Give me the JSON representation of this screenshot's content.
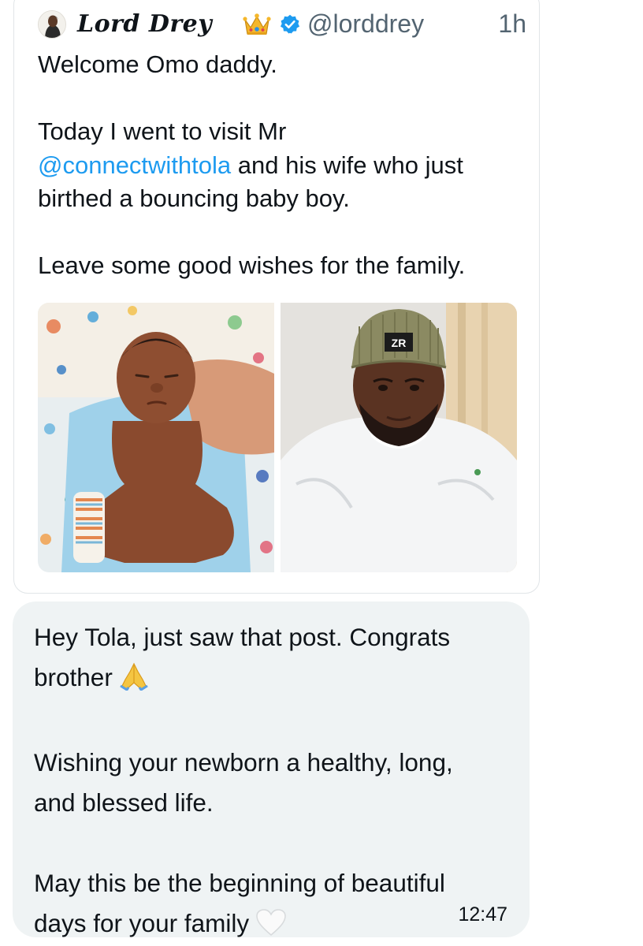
{
  "tweet": {
    "display_name": "Lord Drey",
    "handle": "@lorddrey",
    "time": "1h",
    "avatar_icon": "avatar-photo",
    "crown_icon": "crown-emoji",
    "verified_icon": "verified-badge",
    "line1": "Welcome Omo daddy.",
    "line2": "Today I went to visit Mr",
    "mention": "@connectwithtola",
    "line3_rest": " and his wife who just",
    "line4": "birthed a bouncing baby boy.",
    "line5": "Leave some good wishes for the family.",
    "media": [
      "baby-photo",
      "man-selfie-photo"
    ],
    "cap_logo": "ZR"
  },
  "dm": {
    "line1": "Hey Tola, just saw that post. Congrats",
    "line2": "brother",
    "pray_icon": "folded-hands-emoji",
    "line3": "Wishing your newborn a healthy, long,",
    "line4": "and blessed life.",
    "line5": "May this be the beginning of beautiful",
    "line6": "days for your family",
    "heart_icon": "white-heart-emoji",
    "time": "12:47"
  },
  "colors": {
    "link": "#1d9bf0",
    "secondary_text": "#536471",
    "bubble": "#eff3f4",
    "verified": "#1d9bf0"
  }
}
